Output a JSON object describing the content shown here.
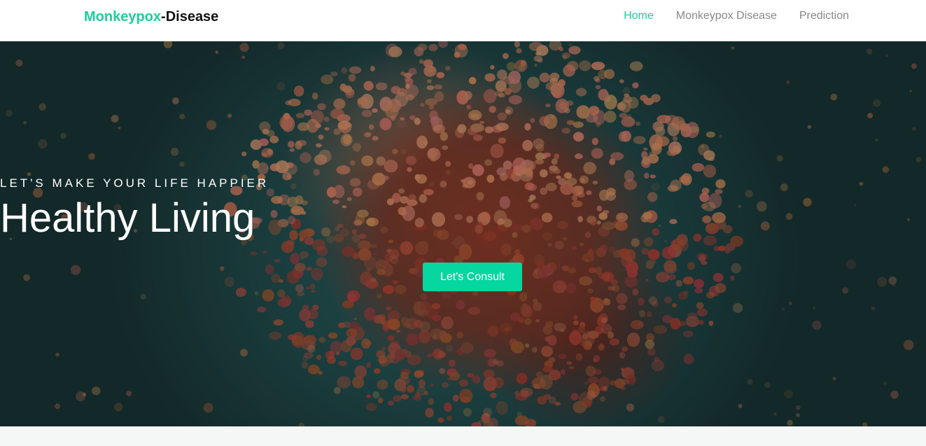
{
  "brand": {
    "name_part1": "Monkeypox",
    "name_part2": "-Disease",
    "accent_color": "#1bcf9d"
  },
  "nav": {
    "items": [
      {
        "label": "Home",
        "active": true
      },
      {
        "label": "Monkeypox Disease",
        "active": false
      },
      {
        "label": "Prediction",
        "active": false
      }
    ]
  },
  "hero": {
    "tagline": "LET'S MAKE YOUR LIFE HAPPIER",
    "headline": "Healthy Living",
    "cta_label": "Let's Consult",
    "cta_color": "#06d6a0"
  }
}
